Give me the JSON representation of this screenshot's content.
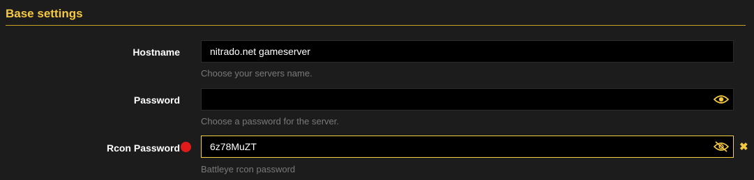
{
  "section": {
    "title": "Base settings"
  },
  "hostname": {
    "label": "Hostname",
    "value": "nitrado.net gameserver",
    "hint": "Choose your servers name."
  },
  "password": {
    "label": "Password",
    "value": "",
    "hint": "Choose a password for the server.",
    "icon": "eye-icon"
  },
  "rcon": {
    "label": "Rcon Password",
    "value": "6z78MuZT",
    "hint": "Battleye rcon password",
    "icon": "eye-slash-icon",
    "clear_icon": "close-icon",
    "required_indicator": "required-dot"
  },
  "colors": {
    "accent": "#f5c842",
    "background": "#1c1c1c",
    "field": "#000000",
    "required": "#e01b1b",
    "hint": "#7a7a7a"
  }
}
